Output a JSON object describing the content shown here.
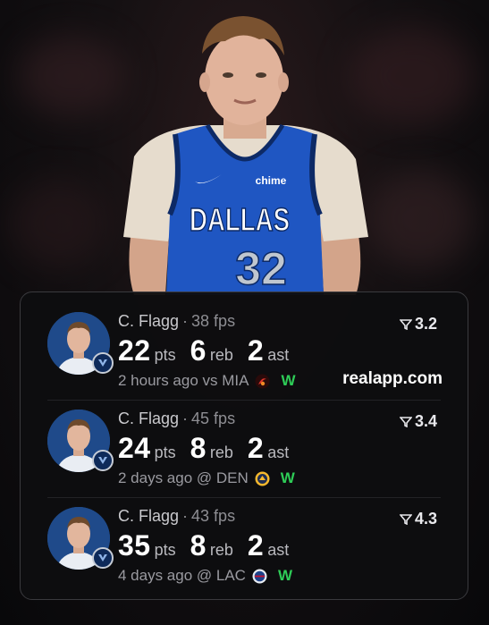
{
  "colors": {
    "background": "#0b0b0d",
    "card_bg": "#0e0e10",
    "card_border": "#3a3a3e",
    "win_green": "#2ecc57",
    "jersey_blue": "#1f56c2"
  },
  "hero": {
    "jersey_text": "DALLAS",
    "jersey_number": "32",
    "sponsor": "chime"
  },
  "watermark": "realapp.com",
  "games": [
    {
      "player": "C. Flagg",
      "separator": "·",
      "fps": "38 fps",
      "points": "22",
      "points_unit": "pts",
      "rebounds": "6",
      "rebounds_unit": "reb",
      "assists": "2",
      "assists_unit": "ast",
      "when": "2 hours ago vs MIA",
      "opponent_icon": "heat-logo-icon",
      "result": "W",
      "rating": "3.2"
    },
    {
      "player": "C. Flagg",
      "separator": "·",
      "fps": "45 fps",
      "points": "24",
      "points_unit": "pts",
      "rebounds": "8",
      "rebounds_unit": "reb",
      "assists": "2",
      "assists_unit": "ast",
      "when": "2 days ago @ DEN",
      "opponent_icon": "nuggets-logo-icon",
      "result": "W",
      "rating": "3.4"
    },
    {
      "player": "C. Flagg",
      "separator": "·",
      "fps": "43 fps",
      "points": "35",
      "points_unit": "pts",
      "rebounds": "8",
      "rebounds_unit": "reb",
      "assists": "2",
      "assists_unit": "ast",
      "when": "4 days ago @ LAC",
      "opponent_icon": "clippers-logo-icon",
      "result": "W",
      "rating": "4.3"
    }
  ]
}
